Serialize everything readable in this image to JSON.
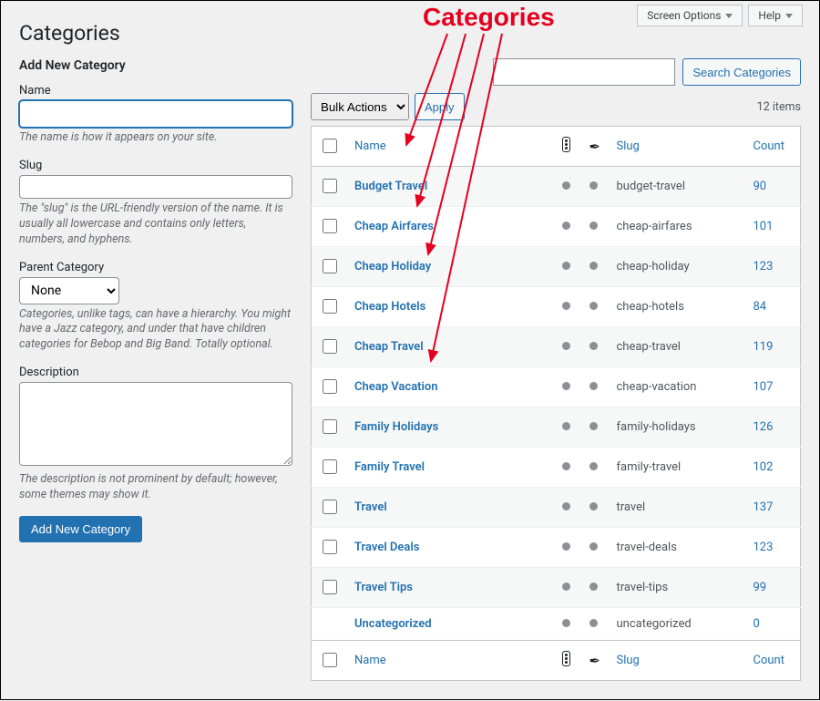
{
  "topTabs": {
    "screenOptions": "Screen Options",
    "help": "Help"
  },
  "annotation": {
    "title": "Categories"
  },
  "title": "Categories",
  "left": {
    "heading": "Add New Category",
    "name": {
      "label": "Name",
      "value": "",
      "help": "The name is how it appears on your site."
    },
    "slug": {
      "label": "Slug",
      "value": "",
      "help": "The \"slug\" is the URL-friendly version of the name. It is usually all lowercase and contains only letters, numbers, and hyphens."
    },
    "parent": {
      "label": "Parent Category",
      "selected": "None",
      "help": "Categories, unlike tags, can have a hierarchy. You might have a Jazz category, and under that have children categories for Bebop and Big Band. Totally optional."
    },
    "description": {
      "label": "Description",
      "value": "",
      "help": "The description is not prominent by default; however, some themes may show it."
    },
    "submit": "Add New Category"
  },
  "right": {
    "search": {
      "value": "",
      "button": "Search Categories"
    },
    "bulk": {
      "selected": "Bulk Actions",
      "apply": "Apply"
    },
    "itemsCount": "12 items",
    "headers": {
      "name": "Name",
      "slug": "Slug",
      "count": "Count"
    },
    "rows": [
      {
        "name": "Budget Travel",
        "slug": "budget-travel",
        "count": "90",
        "cb": true
      },
      {
        "name": "Cheap Airfares",
        "slug": "cheap-airfares",
        "count": "101",
        "cb": true
      },
      {
        "name": "Cheap Holiday",
        "slug": "cheap-holiday",
        "count": "123",
        "cb": true
      },
      {
        "name": "Cheap Hotels",
        "slug": "cheap-hotels",
        "count": "84",
        "cb": true
      },
      {
        "name": "Cheap Travel",
        "slug": "cheap-travel",
        "count": "119",
        "cb": true
      },
      {
        "name": "Cheap Vacation",
        "slug": "cheap-vacation",
        "count": "107",
        "cb": true
      },
      {
        "name": "Family Holidays",
        "slug": "family-holidays",
        "count": "126",
        "cb": true
      },
      {
        "name": "Family Travel",
        "slug": "family-travel",
        "count": "102",
        "cb": true
      },
      {
        "name": "Travel",
        "slug": "travel",
        "count": "137",
        "cb": true
      },
      {
        "name": "Travel Deals",
        "slug": "travel-deals",
        "count": "123",
        "cb": true
      },
      {
        "name": "Travel Tips",
        "slug": "travel-tips",
        "count": "99",
        "cb": true
      },
      {
        "name": "Uncategorized",
        "slug": "uncategorized",
        "count": "0",
        "cb": false
      }
    ]
  }
}
